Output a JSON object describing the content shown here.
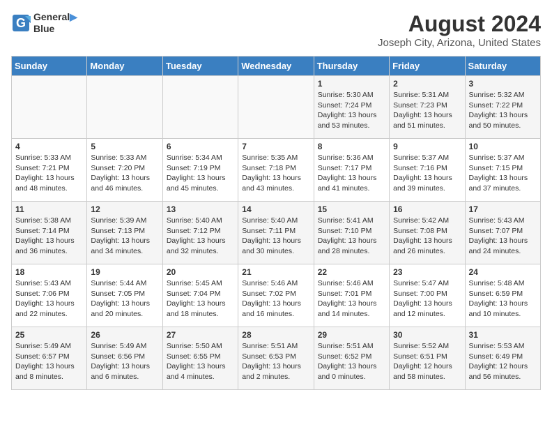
{
  "header": {
    "logo_line1": "General",
    "logo_line2": "Blue",
    "month": "August 2024",
    "location": "Joseph City, Arizona, United States"
  },
  "days_of_week": [
    "Sunday",
    "Monday",
    "Tuesday",
    "Wednesday",
    "Thursday",
    "Friday",
    "Saturday"
  ],
  "weeks": [
    [
      {
        "day": "",
        "info": ""
      },
      {
        "day": "",
        "info": ""
      },
      {
        "day": "",
        "info": ""
      },
      {
        "day": "",
        "info": ""
      },
      {
        "day": "1",
        "info": "Sunrise: 5:30 AM\nSunset: 7:24 PM\nDaylight: 13 hours\nand 53 minutes."
      },
      {
        "day": "2",
        "info": "Sunrise: 5:31 AM\nSunset: 7:23 PM\nDaylight: 13 hours\nand 51 minutes."
      },
      {
        "day": "3",
        "info": "Sunrise: 5:32 AM\nSunset: 7:22 PM\nDaylight: 13 hours\nand 50 minutes."
      }
    ],
    [
      {
        "day": "4",
        "info": "Sunrise: 5:33 AM\nSunset: 7:21 PM\nDaylight: 13 hours\nand 48 minutes."
      },
      {
        "day": "5",
        "info": "Sunrise: 5:33 AM\nSunset: 7:20 PM\nDaylight: 13 hours\nand 46 minutes."
      },
      {
        "day": "6",
        "info": "Sunrise: 5:34 AM\nSunset: 7:19 PM\nDaylight: 13 hours\nand 45 minutes."
      },
      {
        "day": "7",
        "info": "Sunrise: 5:35 AM\nSunset: 7:18 PM\nDaylight: 13 hours\nand 43 minutes."
      },
      {
        "day": "8",
        "info": "Sunrise: 5:36 AM\nSunset: 7:17 PM\nDaylight: 13 hours\nand 41 minutes."
      },
      {
        "day": "9",
        "info": "Sunrise: 5:37 AM\nSunset: 7:16 PM\nDaylight: 13 hours\nand 39 minutes."
      },
      {
        "day": "10",
        "info": "Sunrise: 5:37 AM\nSunset: 7:15 PM\nDaylight: 13 hours\nand 37 minutes."
      }
    ],
    [
      {
        "day": "11",
        "info": "Sunrise: 5:38 AM\nSunset: 7:14 PM\nDaylight: 13 hours\nand 36 minutes."
      },
      {
        "day": "12",
        "info": "Sunrise: 5:39 AM\nSunset: 7:13 PM\nDaylight: 13 hours\nand 34 minutes."
      },
      {
        "day": "13",
        "info": "Sunrise: 5:40 AM\nSunset: 7:12 PM\nDaylight: 13 hours\nand 32 minutes."
      },
      {
        "day": "14",
        "info": "Sunrise: 5:40 AM\nSunset: 7:11 PM\nDaylight: 13 hours\nand 30 minutes."
      },
      {
        "day": "15",
        "info": "Sunrise: 5:41 AM\nSunset: 7:10 PM\nDaylight: 13 hours\nand 28 minutes."
      },
      {
        "day": "16",
        "info": "Sunrise: 5:42 AM\nSunset: 7:08 PM\nDaylight: 13 hours\nand 26 minutes."
      },
      {
        "day": "17",
        "info": "Sunrise: 5:43 AM\nSunset: 7:07 PM\nDaylight: 13 hours\nand 24 minutes."
      }
    ],
    [
      {
        "day": "18",
        "info": "Sunrise: 5:43 AM\nSunset: 7:06 PM\nDaylight: 13 hours\nand 22 minutes."
      },
      {
        "day": "19",
        "info": "Sunrise: 5:44 AM\nSunset: 7:05 PM\nDaylight: 13 hours\nand 20 minutes."
      },
      {
        "day": "20",
        "info": "Sunrise: 5:45 AM\nSunset: 7:04 PM\nDaylight: 13 hours\nand 18 minutes."
      },
      {
        "day": "21",
        "info": "Sunrise: 5:46 AM\nSunset: 7:02 PM\nDaylight: 13 hours\nand 16 minutes."
      },
      {
        "day": "22",
        "info": "Sunrise: 5:46 AM\nSunset: 7:01 PM\nDaylight: 13 hours\nand 14 minutes."
      },
      {
        "day": "23",
        "info": "Sunrise: 5:47 AM\nSunset: 7:00 PM\nDaylight: 13 hours\nand 12 minutes."
      },
      {
        "day": "24",
        "info": "Sunrise: 5:48 AM\nSunset: 6:59 PM\nDaylight: 13 hours\nand 10 minutes."
      }
    ],
    [
      {
        "day": "25",
        "info": "Sunrise: 5:49 AM\nSunset: 6:57 PM\nDaylight: 13 hours\nand 8 minutes."
      },
      {
        "day": "26",
        "info": "Sunrise: 5:49 AM\nSunset: 6:56 PM\nDaylight: 13 hours\nand 6 minutes."
      },
      {
        "day": "27",
        "info": "Sunrise: 5:50 AM\nSunset: 6:55 PM\nDaylight: 13 hours\nand 4 minutes."
      },
      {
        "day": "28",
        "info": "Sunrise: 5:51 AM\nSunset: 6:53 PM\nDaylight: 13 hours\nand 2 minutes."
      },
      {
        "day": "29",
        "info": "Sunrise: 5:51 AM\nSunset: 6:52 PM\nDaylight: 13 hours\nand 0 minutes."
      },
      {
        "day": "30",
        "info": "Sunrise: 5:52 AM\nSunset: 6:51 PM\nDaylight: 12 hours\nand 58 minutes."
      },
      {
        "day": "31",
        "info": "Sunrise: 5:53 AM\nSunset: 6:49 PM\nDaylight: 12 hours\nand 56 minutes."
      }
    ]
  ]
}
